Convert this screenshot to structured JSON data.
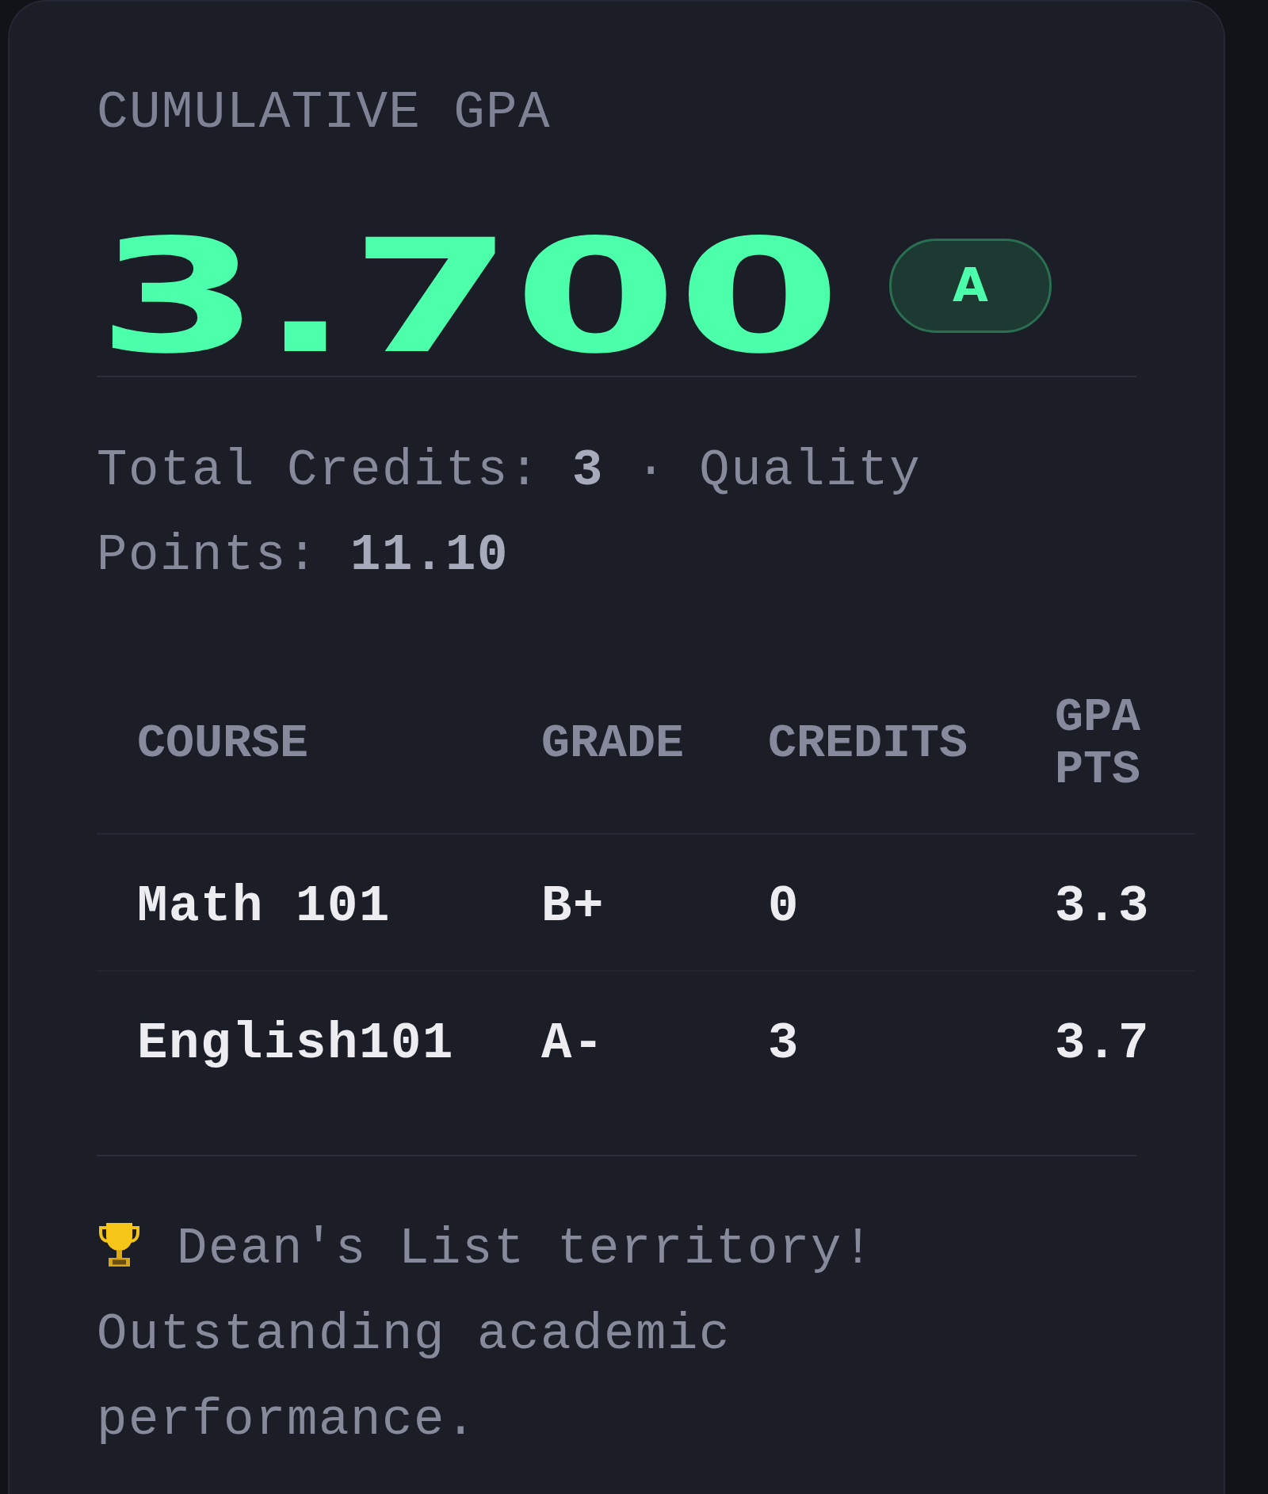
{
  "gpa_card": {
    "title": "CUMULATIVE GPA",
    "gpa": "3.700",
    "letter_grade": "A",
    "summary": "Total Credits: **3** · Quality Points: **11.10**"
  },
  "table": {
    "columns": [
      "COURSE",
      "GRADE",
      "CREDITS",
      "GPA PTS"
    ],
    "rows": [
      {
        "cells": [
          "Math 101",
          "B+",
          "0",
          "3.3"
        ]
      },
      {
        "cells": [
          "English101",
          "A-",
          "3",
          "3.7"
        ]
      }
    ]
  },
  "message": {
    "headline": "Dean's List territory!",
    "text": "Outstanding academic performance."
  }
}
